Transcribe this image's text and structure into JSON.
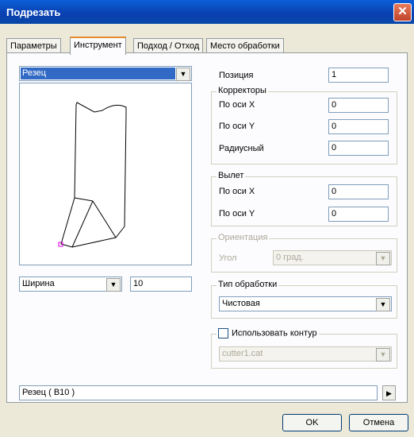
{
  "window": {
    "title": "Подрезать"
  },
  "tabs": [
    {
      "label": "Параметры"
    },
    {
      "label": "Инструмент"
    },
    {
      "label": "Подход / Отход"
    },
    {
      "label": "Место обработки"
    }
  ],
  "tool_select": {
    "value": "Резец"
  },
  "dimension": {
    "select_value": "Ширина",
    "value": "10"
  },
  "position": {
    "label": "Позиция",
    "value": "1"
  },
  "correctors": {
    "title": "Корректоры",
    "x_label": "По оси X",
    "x_value": "0",
    "y_label": "По оси Y",
    "y_value": "0",
    "radius_label": "Радиусный",
    "radius_value": "0"
  },
  "overhang": {
    "title": "Вылет",
    "x_label": "По оси X",
    "x_value": "0",
    "y_label": "По оси Y",
    "y_value": "0"
  },
  "orientation": {
    "title": "Ориентация",
    "angle_label": "Угол",
    "angle_value": "0 град."
  },
  "process_type": {
    "title": "Тип обработки",
    "value": "Чистовая"
  },
  "contour": {
    "checkbox_label": "Использовать контур",
    "checked": false,
    "value": "cutter1.cat"
  },
  "bottom_field": {
    "value": "Резец ( B10 )"
  },
  "buttons": {
    "ok": "OK",
    "cancel": "Отмена"
  }
}
